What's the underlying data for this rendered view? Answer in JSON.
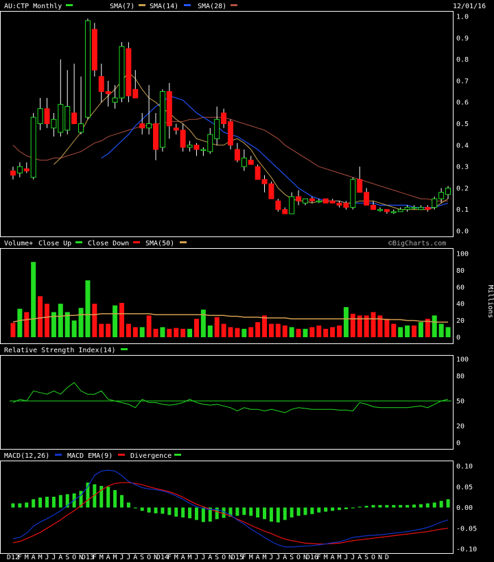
{
  "header": {
    "symbol_title": "AU:CTP Monthly",
    "date": "12/01/16",
    "sma7_label": "SMA(7)",
    "sma14_label": "SMA(14)",
    "sma28_label": "SMA(28)"
  },
  "volume_header": {
    "title": "Volume+",
    "close_up_label": "Close Up",
    "close_down_label": "Close Down",
    "sma_label": "SMA(50)",
    "watermark": "©BigCharts.com",
    "units": "Millions"
  },
  "rsi_header": {
    "title": "Relative Strength Index(14)"
  },
  "macd_header": {
    "title": "MACD(12,26)",
    "ema_label": "MACD EMA(9)",
    "div_label": "Divergence"
  },
  "colors": {
    "background": "#000000",
    "up": "#22dd22",
    "down": "#ff1111",
    "sma7": "#c8a050",
    "sma14": "#2255ff",
    "sma28": "#b05040",
    "vol_sma": "#d4a050",
    "rsi": "#22dd22",
    "macd": "#1133cc",
    "macd_ema": "#ee1111",
    "divergence": "#22dd22",
    "grid": "#444444"
  },
  "chart_data": [
    {
      "type": "candlestick",
      "title": "AU:CTP Monthly",
      "ylim": [
        0,
        1.0
      ],
      "yticks": [
        "1.0",
        "0.9",
        "0.8",
        "0.7",
        "0.6",
        "0.5",
        "0.4",
        "0.3",
        "0.2",
        "0.1",
        "0.0"
      ],
      "x_labels": [
        "D12",
        "F",
        "M",
        "A",
        "M",
        "J",
        "J",
        "A",
        "S",
        "O",
        "N",
        "D13",
        "F",
        "M",
        "A",
        "M",
        "J",
        "J",
        "A",
        "S",
        "O",
        "N",
        "D14",
        "F",
        "M",
        "A",
        "M",
        "J",
        "J",
        "A",
        "S",
        "O",
        "N",
        "D15",
        "F",
        "M",
        "A",
        "M",
        "J",
        "J",
        "A",
        "S",
        "O",
        "N",
        "D16",
        "F",
        "M",
        "A",
        "M",
        "J",
        "J",
        "A",
        "S",
        "O",
        "N",
        "D"
      ],
      "candles": [
        [
          0.28,
          0.3,
          0.24,
          0.26
        ],
        [
          0.27,
          0.32,
          0.25,
          0.3
        ],
        [
          0.29,
          0.32,
          0.27,
          0.28
        ],
        [
          0.25,
          0.55,
          0.24,
          0.53
        ],
        [
          0.5,
          0.62,
          0.47,
          0.57
        ],
        [
          0.57,
          0.62,
          0.48,
          0.5
        ],
        [
          0.48,
          0.55,
          0.44,
          0.52
        ],
        [
          0.46,
          0.8,
          0.44,
          0.59
        ],
        [
          0.47,
          0.75,
          0.45,
          0.58
        ],
        [
          0.55,
          0.78,
          0.52,
          0.5
        ],
        [
          0.46,
          0.72,
          0.45,
          0.5
        ],
        [
          0.53,
          0.99,
          0.52,
          0.98
        ],
        [
          0.94,
          0.97,
          0.72,
          0.75
        ],
        [
          0.72,
          0.78,
          0.6,
          0.65
        ],
        [
          0.65,
          0.7,
          0.58,
          0.64
        ],
        [
          0.6,
          0.68,
          0.57,
          0.62
        ],
        [
          0.62,
          0.88,
          0.6,
          0.86
        ],
        [
          0.85,
          0.88,
          0.6,
          0.63
        ],
        [
          0.66,
          0.75,
          0.63,
          0.62
        ],
        [
          0.5,
          0.55,
          0.45,
          0.48
        ],
        [
          0.48,
          0.68,
          0.45,
          0.5
        ],
        [
          0.5,
          0.55,
          0.33,
          0.38
        ],
        [
          0.39,
          0.66,
          0.37,
          0.65
        ],
        [
          0.65,
          0.69,
          0.43,
          0.49
        ],
        [
          0.48,
          0.5,
          0.45,
          0.47
        ],
        [
          0.47,
          0.5,
          0.37,
          0.39
        ],
        [
          0.39,
          0.42,
          0.37,
          0.4
        ],
        [
          0.4,
          0.41,
          0.35,
          0.38
        ],
        [
          0.38,
          0.39,
          0.35,
          0.38
        ],
        [
          0.37,
          0.48,
          0.36,
          0.45
        ],
        [
          0.43,
          0.58,
          0.4,
          0.52
        ],
        [
          0.55,
          0.57,
          0.48,
          0.5
        ],
        [
          0.51,
          0.52,
          0.38,
          0.4
        ],
        [
          0.38,
          0.41,
          0.32,
          0.33
        ],
        [
          0.3,
          0.38,
          0.28,
          0.34
        ],
        [
          0.33,
          0.35,
          0.31,
          0.31
        ],
        [
          0.3,
          0.31,
          0.24,
          0.24
        ],
        [
          0.24,
          0.26,
          0.18,
          0.22
        ],
        [
          0.22,
          0.23,
          0.15,
          0.15
        ],
        [
          0.14,
          0.15,
          0.09,
          0.1
        ],
        [
          0.1,
          0.11,
          0.08,
          0.08
        ],
        [
          0.08,
          0.18,
          0.08,
          0.16
        ],
        [
          0.16,
          0.19,
          0.12,
          0.14
        ],
        [
          0.13,
          0.15,
          0.12,
          0.15
        ],
        [
          0.15,
          0.16,
          0.13,
          0.14
        ],
        [
          0.14,
          0.15,
          0.13,
          0.14
        ],
        [
          0.15,
          0.15,
          0.13,
          0.13
        ],
        [
          0.14,
          0.15,
          0.13,
          0.13
        ],
        [
          0.13,
          0.14,
          0.11,
          0.12
        ],
        [
          0.13,
          0.14,
          0.1,
          0.11
        ],
        [
          0.11,
          0.25,
          0.1,
          0.24
        ],
        [
          0.24,
          0.3,
          0.18,
          0.18
        ],
        [
          0.18,
          0.2,
          0.12,
          0.12
        ],
        [
          0.12,
          0.14,
          0.1,
          0.1
        ],
        [
          0.1,
          0.11,
          0.09,
          0.1
        ],
        [
          0.1,
          0.1,
          0.08,
          0.09
        ],
        [
          0.09,
          0.1,
          0.08,
          0.09
        ],
        [
          0.09,
          0.11,
          0.09,
          0.1
        ],
        [
          0.1,
          0.12,
          0.09,
          0.11
        ],
        [
          0.11,
          0.12,
          0.1,
          0.11
        ],
        [
          0.1,
          0.12,
          0.1,
          0.11
        ],
        [
          0.11,
          0.12,
          0.09,
          0.1
        ],
        [
          0.11,
          0.16,
          0.1,
          0.15
        ],
        [
          0.15,
          0.2,
          0.13,
          0.18
        ],
        [
          0.17,
          0.21,
          0.15,
          0.2
        ]
      ],
      "sma7": [
        null,
        null,
        null,
        null,
        null,
        null,
        0.31,
        0.34,
        0.38,
        0.42,
        0.46,
        0.52,
        0.56,
        0.6,
        0.63,
        0.66,
        0.7,
        0.74,
        0.71,
        0.66,
        0.62,
        0.6,
        0.57,
        0.55,
        0.52,
        0.5,
        0.47,
        0.43,
        0.42,
        0.41,
        0.4,
        0.4,
        0.42,
        0.43,
        0.41,
        0.38,
        0.33,
        0.29,
        0.25,
        0.2,
        0.17,
        0.15,
        0.14,
        0.14,
        0.13,
        0.14,
        0.14,
        0.14,
        0.14,
        0.13,
        0.13,
        0.14,
        0.14,
        0.14,
        0.13,
        0.12,
        0.11,
        0.1,
        0.1,
        0.1,
        0.1,
        0.1,
        0.11,
        0.13,
        0.15
      ],
      "sma14": [
        null,
        null,
        null,
        null,
        null,
        null,
        null,
        null,
        null,
        null,
        null,
        null,
        null,
        0.34,
        0.36,
        0.39,
        0.42,
        0.45,
        0.49,
        0.52,
        0.55,
        0.58,
        0.6,
        0.63,
        0.62,
        0.61,
        0.58,
        0.55,
        0.53,
        0.51,
        0.49,
        0.46,
        0.45,
        0.44,
        0.42,
        0.4,
        0.38,
        0.35,
        0.32,
        0.29,
        0.26,
        0.23,
        0.2,
        0.18,
        0.16,
        0.15,
        0.14,
        0.14,
        0.14,
        0.13,
        0.13,
        0.13,
        0.13,
        0.13,
        0.12,
        0.12,
        0.12,
        0.12,
        0.12,
        0.11,
        0.11,
        0.11,
        0.11,
        0.12,
        0.13
      ],
      "sma28": [
        0.4,
        0.37,
        0.35,
        0.34,
        0.33,
        0.33,
        0.34,
        0.34,
        0.35,
        0.36,
        0.37,
        0.39,
        0.41,
        0.42,
        0.44,
        0.45,
        0.46,
        0.47,
        0.48,
        0.49,
        0.49,
        0.5,
        0.5,
        0.51,
        0.51,
        0.51,
        0.52,
        0.52,
        0.53,
        0.53,
        0.53,
        0.53,
        0.52,
        0.51,
        0.5,
        0.49,
        0.48,
        0.47,
        0.45,
        0.43,
        0.4,
        0.38,
        0.36,
        0.34,
        0.32,
        0.3,
        0.29,
        0.28,
        0.27,
        0.26,
        0.25,
        0.24,
        0.23,
        0.22,
        0.21,
        0.2,
        0.19,
        0.18,
        0.17,
        0.16,
        0.15,
        0.15,
        0.14,
        0.14,
        0.14
      ]
    },
    {
      "type": "bar",
      "title": "Volume+",
      "ylim": [
        0,
        100
      ],
      "yticks": [
        "100",
        "80",
        "60",
        "40",
        "20",
        "0"
      ],
      "ylabel": "Millions",
      "values": [
        17,
        34,
        30,
        90,
        49,
        40,
        30,
        40,
        30,
        20,
        35,
        68,
        40,
        16,
        16,
        38,
        41,
        16,
        12,
        12,
        26,
        10,
        12,
        10,
        11,
        10,
        10,
        22,
        33,
        14,
        24,
        16,
        12,
        11,
        10,
        12,
        18,
        26,
        16,
        16,
        14,
        12,
        10,
        10,
        12,
        14,
        10,
        12,
        14,
        36,
        28,
        26,
        26,
        30,
        26,
        22,
        16,
        12,
        14,
        14,
        18,
        22,
        26,
        16,
        12
      ],
      "up": [
        0,
        1,
        0,
        1,
        0,
        0,
        1,
        1,
        1,
        1,
        1,
        1,
        0,
        0,
        0,
        1,
        0,
        0,
        0,
        1,
        0,
        0,
        1,
        0,
        0,
        0,
        1,
        0,
        1,
        1,
        0,
        0,
        0,
        0,
        1,
        0,
        0,
        0,
        0,
        0,
        0,
        1,
        0,
        1,
        0,
        0,
        0,
        0,
        0,
        1,
        0,
        0,
        0,
        0,
        0,
        0,
        0,
        1,
        1,
        0,
        1,
        0,
        1,
        1,
        1
      ],
      "sma50": [
        18,
        20,
        21,
        22,
        23,
        24,
        25,
        25,
        26,
        26,
        27,
        27,
        27,
        28,
        28,
        28,
        28,
        28,
        28,
        28,
        28,
        27,
        27,
        27,
        27,
        27,
        27,
        27,
        27,
        26,
        26,
        26,
        25,
        25,
        24,
        24,
        24,
        23,
        23,
        23,
        23,
        22,
        22,
        22,
        22,
        22,
        22,
        22,
        22,
        22,
        22,
        22,
        22,
        22,
        22,
        21,
        21,
        21,
        20,
        20,
        19,
        19,
        18,
        18,
        18
      ]
    },
    {
      "type": "line",
      "title": "Relative Strength Index(14)",
      "ylim": [
        0,
        100
      ],
      "yticks": [
        "100",
        "80",
        "50",
        "20",
        "0"
      ],
      "reference": 50,
      "values": [
        48,
        52,
        50,
        62,
        60,
        58,
        62,
        58,
        66,
        72,
        62,
        58,
        58,
        62,
        52,
        50,
        48,
        46,
        42,
        52,
        48,
        48,
        46,
        45,
        46,
        48,
        52,
        48,
        46,
        45,
        46,
        44,
        42,
        38,
        42,
        40,
        40,
        38,
        40,
        38,
        36,
        40,
        42,
        41,
        40,
        40,
        40,
        40,
        39,
        39,
        38,
        48,
        46,
        43,
        42,
        42,
        42,
        42,
        42,
        43,
        44,
        42,
        46,
        50,
        52
      ]
    },
    {
      "type": "line",
      "title": "MACD(12,26)",
      "ylim": [
        -0.1,
        0.1
      ],
      "yticks": [
        "0.10",
        "0.05",
        "0.00",
        "-0.05",
        "-0.10"
      ],
      "macd": [
        -0.075,
        -0.072,
        -0.062,
        -0.045,
        -0.035,
        -0.027,
        -0.018,
        -0.008,
        0.005,
        0.018,
        0.03,
        0.05,
        0.078,
        0.088,
        0.09,
        0.088,
        0.077,
        0.063,
        0.055,
        0.048,
        0.045,
        0.043,
        0.04,
        0.035,
        0.028,
        0.02,
        0.01,
        0.002,
        -0.002,
        -0.005,
        -0.005,
        -0.01,
        -0.018,
        -0.03,
        -0.04,
        -0.052,
        -0.062,
        -0.072,
        -0.082,
        -0.09,
        -0.095,
        -0.095,
        -0.094,
        -0.093,
        -0.092,
        -0.09,
        -0.088,
        -0.085,
        -0.083,
        -0.078,
        -0.072,
        -0.07,
        -0.068,
        -0.067,
        -0.066,
        -0.064,
        -0.062,
        -0.06,
        -0.058,
        -0.055,
        -0.052,
        -0.048,
        -0.042,
        -0.035,
        -0.03
      ],
      "macd_ema": [
        -0.085,
        -0.082,
        -0.075,
        -0.068,
        -0.06,
        -0.05,
        -0.04,
        -0.03,
        -0.018,
        -0.008,
        0.005,
        0.018,
        0.03,
        0.042,
        0.052,
        0.058,
        0.06,
        0.06,
        0.058,
        0.055,
        0.05,
        0.046,
        0.042,
        0.038,
        0.032,
        0.025,
        0.016,
        0.008,
        0.002,
        -0.004,
        -0.01,
        -0.015,
        -0.02,
        -0.028,
        -0.035,
        -0.043,
        -0.05,
        -0.057,
        -0.063,
        -0.07,
        -0.076,
        -0.08,
        -0.083,
        -0.086,
        -0.087,
        -0.088,
        -0.088,
        -0.087,
        -0.086,
        -0.083,
        -0.08,
        -0.078,
        -0.076,
        -0.074,
        -0.072,
        -0.07,
        -0.068,
        -0.066,
        -0.064,
        -0.062,
        -0.06,
        -0.058,
        -0.055,
        -0.052,
        -0.05
      ],
      "divergence": [
        0.01,
        0.01,
        0.012,
        0.02,
        0.024,
        0.026,
        0.026,
        0.03,
        0.032,
        0.034,
        0.04,
        0.06,
        0.056,
        0.052,
        0.05,
        0.042,
        0.03,
        0.012,
        -0.002,
        -0.008,
        -0.012,
        -0.014,
        -0.015,
        -0.018,
        -0.022,
        -0.024,
        -0.026,
        -0.03,
        -0.035,
        -0.034,
        -0.028,
        -0.025,
        -0.022,
        -0.02,
        -0.018,
        -0.02,
        -0.024,
        -0.028,
        -0.034,
        -0.036,
        -0.03,
        -0.024,
        -0.02,
        -0.018,
        -0.016,
        -0.012,
        -0.01,
        -0.008,
        -0.006,
        -0.004,
        -0.002,
        0.002,
        0.004,
        0.006,
        0.006,
        0.006,
        0.006,
        0.006,
        0.006,
        0.007,
        0.008,
        0.01,
        0.012,
        0.016,
        0.02
      ]
    }
  ]
}
